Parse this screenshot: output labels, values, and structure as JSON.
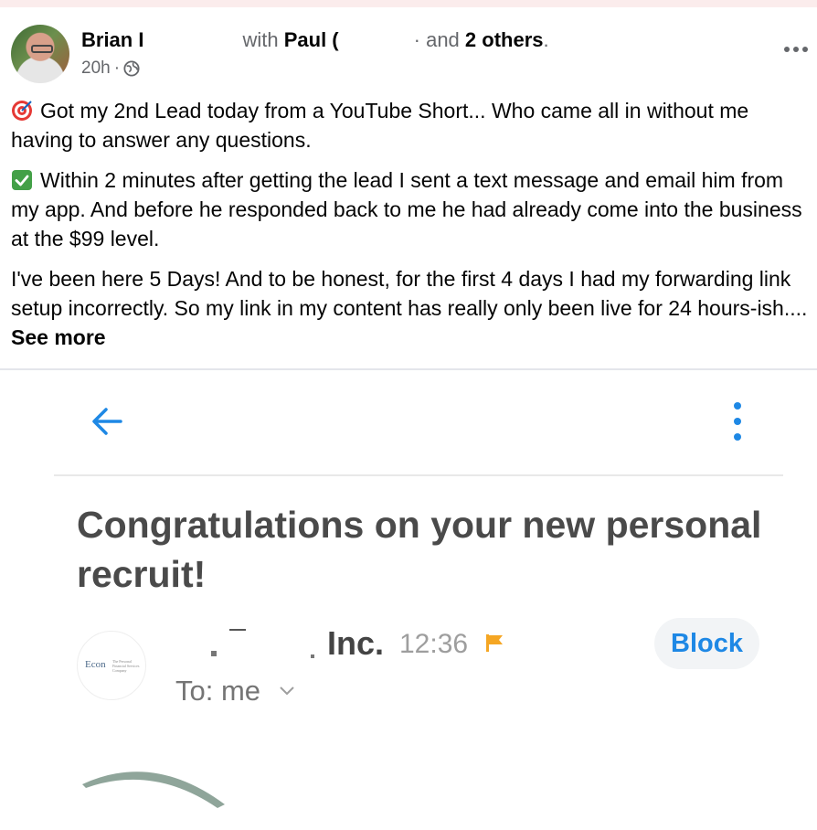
{
  "post": {
    "author": "Brian I",
    "with_label": "with",
    "tagged": "Paul (",
    "mid_fragment": "·",
    "and_label": "and",
    "others": "2 others",
    "period": ".",
    "time": "20h",
    "dot": "·",
    "privacy_icon": "globe-icon",
    "paragraphs": [
      "Got my 2nd Lead today from a YouTube Short... Who came all in without me having to answer any questions.",
      "Within 2 minutes after getting the lead I sent a text message and email him from my app. And before he responded back to me he had already come into the business at the $99 level.",
      "I've been here 5 Days! And to be honest, for the first 4 days I had my forwarding link setup incorrectly. So my link in my content has really only been live for 24 hours-ish.... "
    ],
    "see_more": "See more",
    "paragraph_icons": [
      "direct-hit-emoji-icon",
      "check-mark-emoji-icon"
    ]
  },
  "email": {
    "subject": "Congratulations on your new personal recruit!",
    "sender_suffix": "Inc.",
    "time": "12:36",
    "block_label": "Block",
    "to_label": "To: me",
    "logo_text": "Econ",
    "logo_small": "The Personal Financial Services Company",
    "accent_color": "#1e88e5",
    "flag_color": "#f5a623"
  }
}
